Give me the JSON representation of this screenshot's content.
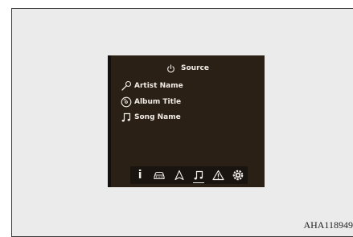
{
  "screen": {
    "source_label": "Source",
    "rows": [
      {
        "icon": "microphone-icon",
        "label": "Artist Name"
      },
      {
        "icon": "disc-icon",
        "label": "Album Title"
      },
      {
        "icon": "music-note-icon",
        "label": "Song Name"
      }
    ]
  },
  "tabs": [
    {
      "icon": "info-icon",
      "label": "i"
    },
    {
      "icon": "car-icon",
      "label": ""
    },
    {
      "icon": "navigation-icon",
      "label": ""
    },
    {
      "icon": "music-note-icon",
      "label": "",
      "active": true
    },
    {
      "icon": "warning-icon",
      "label": ""
    },
    {
      "icon": "settings-icon",
      "label": ""
    }
  ],
  "figure_code": "AHA118949"
}
